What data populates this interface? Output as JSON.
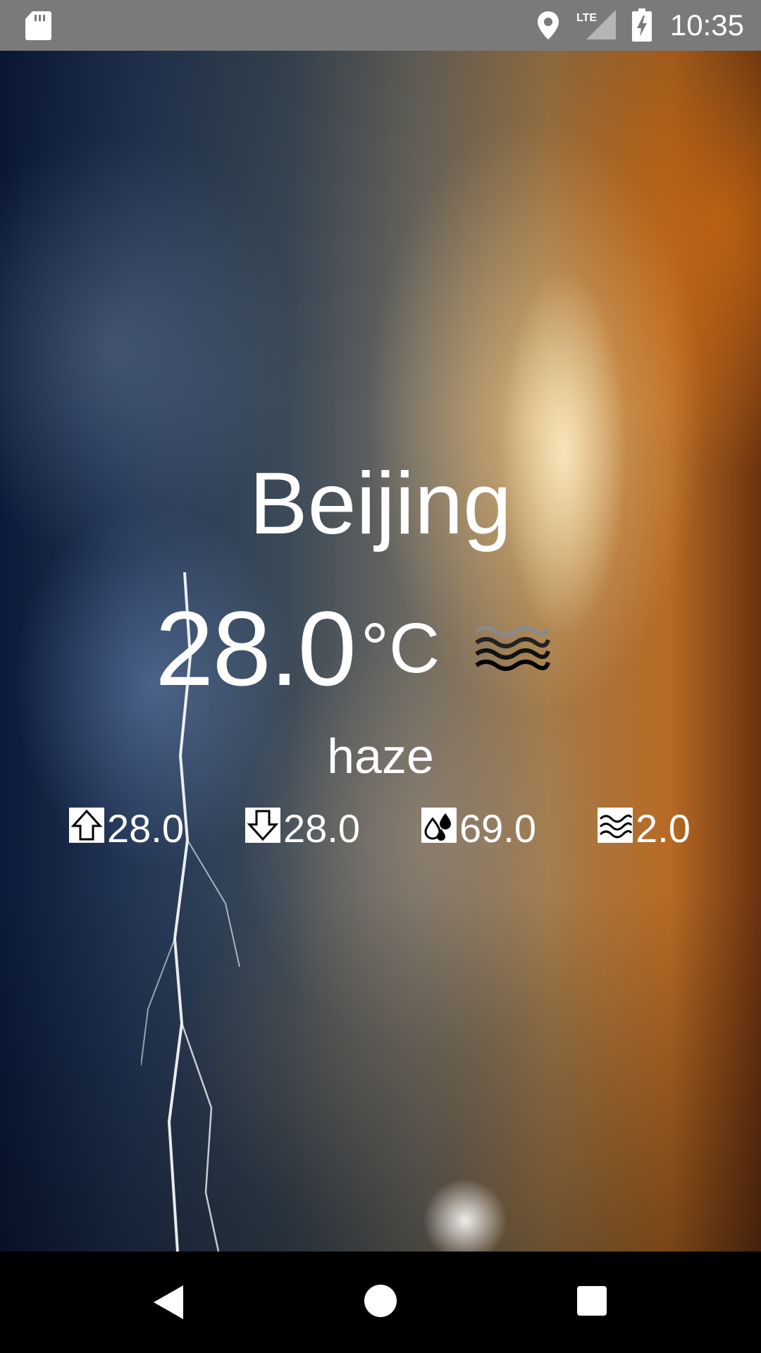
{
  "status_bar": {
    "time": "10:35",
    "network": "LTE",
    "icons": [
      "sd-card-icon",
      "location-icon",
      "lte-signal-icon",
      "battery-charging-icon"
    ]
  },
  "weather": {
    "city": "Beijing",
    "temperature": "28.0",
    "unit": "°C",
    "condition": "haze",
    "condition_icon": "haze-icon"
  },
  "stats": [
    {
      "icon": "temp-max-arrow-up-icon",
      "value": "28.0"
    },
    {
      "icon": "temp-min-arrow-down-icon",
      "value": "28.0"
    },
    {
      "icon": "humidity-drops-icon",
      "value": "69.0"
    },
    {
      "icon": "wind-waves-icon",
      "value": "2.0"
    }
  ],
  "nav_bar": {
    "icons": [
      "back-icon",
      "home-icon",
      "recent-apps-icon"
    ]
  }
}
